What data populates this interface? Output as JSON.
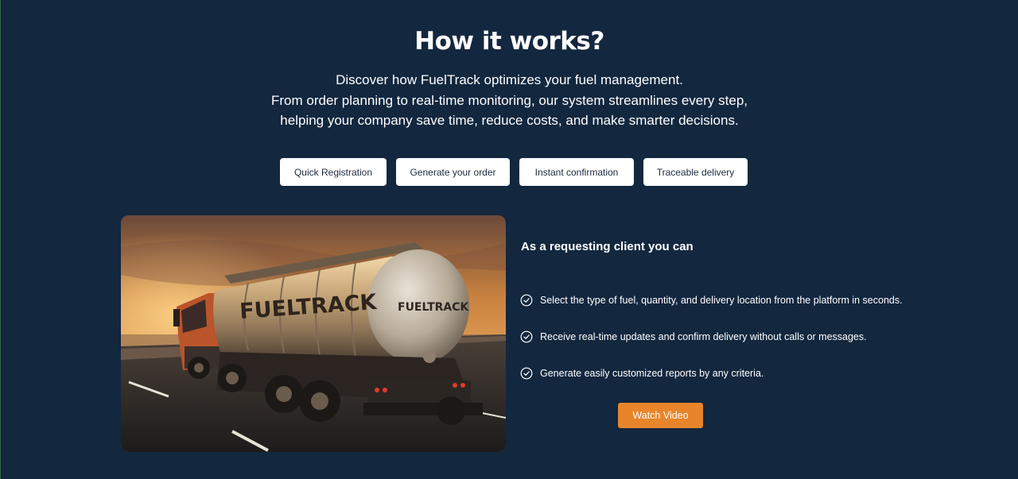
{
  "section": {
    "title": "How it works?",
    "description": [
      "Discover how FuelTrack optimizes your fuel management.",
      "From order planning to real-time monitoring, our system streamlines every step,",
      "helping your company save time, reduce costs, and make smarter decisions."
    ]
  },
  "tabs": [
    {
      "label": "Quick Registration"
    },
    {
      "label": "Generate your order"
    },
    {
      "label": "Instant confirmation"
    },
    {
      "label": "Traceable delivery"
    }
  ],
  "hero_image": {
    "tank_text_side": "FUELTRACK",
    "tank_text_back": "FUELTRACK"
  },
  "panel": {
    "title": "As a requesting client you can",
    "features": [
      {
        "text": "Select the type of fuel, quantity, and delivery location from the platform in seconds.",
        "icon": "check-circle-icon"
      },
      {
        "text": "Receive real-time updates and confirm delivery without calls or messages.",
        "icon": "check-circle-icon"
      },
      {
        "text": "Generate easily customized reports by any criteria.",
        "icon": "check-circle-icon"
      }
    ],
    "watch_button": "Watch Video"
  },
  "colors": {
    "background": "#13273f",
    "accent": "#e8852a",
    "tab_bg": "#ffffff",
    "text": "#ffffff"
  }
}
